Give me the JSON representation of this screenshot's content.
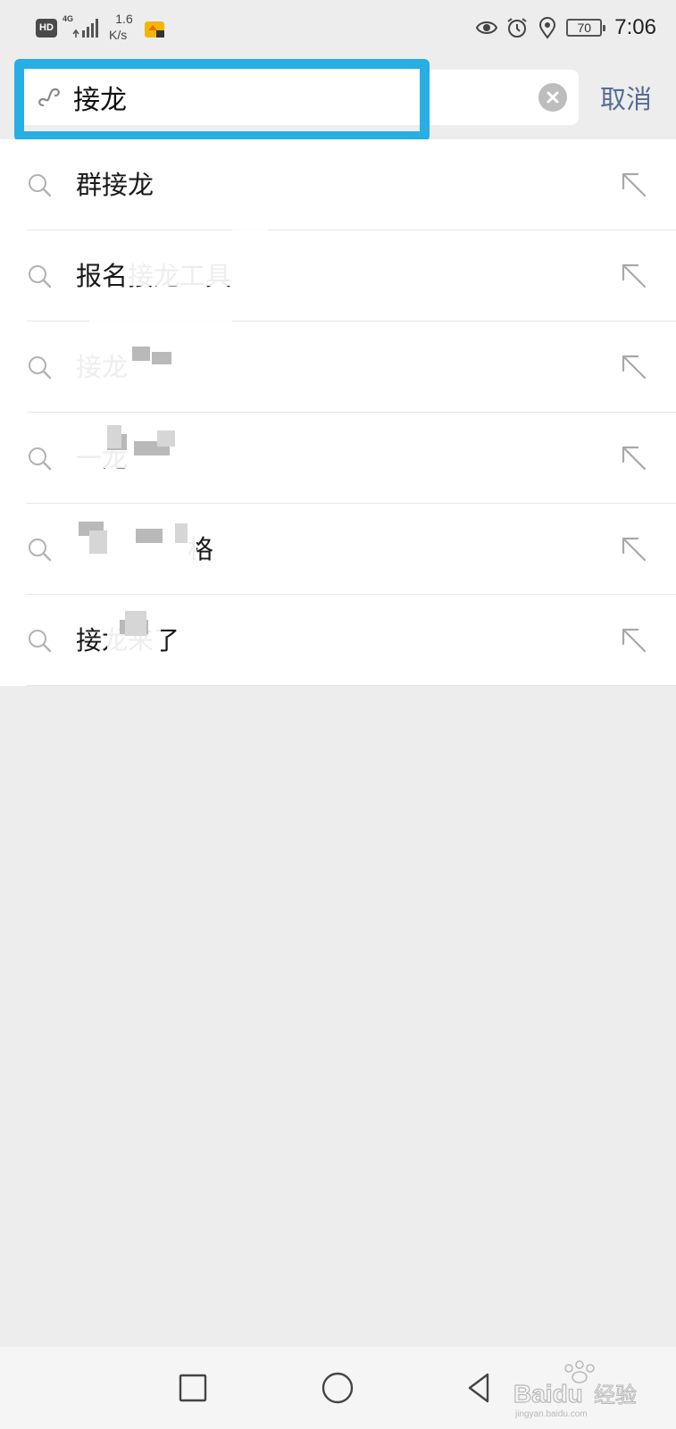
{
  "status_bar": {
    "network_badge": "HD",
    "network_type": "4G",
    "speed_value": "1.6",
    "speed_unit": "K/s",
    "battery": "70",
    "time": "7:06"
  },
  "search": {
    "query": "接龙",
    "cancel_label": "取消"
  },
  "suggestions": [
    {
      "label": "群接龙"
    },
    {
      "label": "报名接龙工具"
    },
    {
      "label": "接龙"
    },
    {
      "label": "一龙"
    },
    {
      "label": "格"
    },
    {
      "label": "接龙来了"
    }
  ],
  "colors": {
    "highlight": "#27aee3",
    "cancel": "#576b95",
    "background": "#ededed"
  },
  "watermark": {
    "brand": "Baidu",
    "suffix": "经验",
    "site": "jingyan.baidu.com"
  }
}
